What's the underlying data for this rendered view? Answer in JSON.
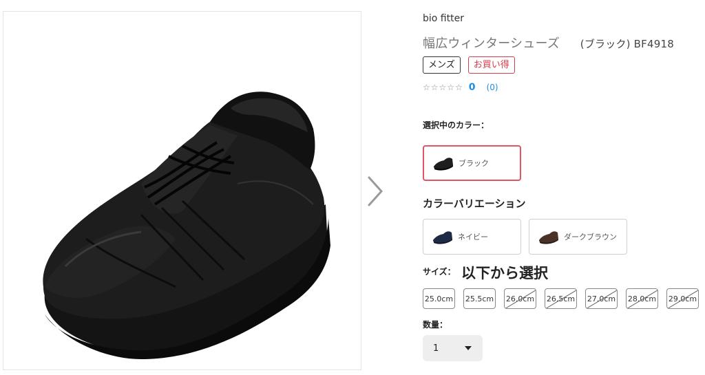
{
  "product": {
    "brand": "bio fitter",
    "title": "幅広ウィンターシューズ",
    "title_suffix": "(ブラック) BF4918",
    "image_icon": "black-walking-shoe-photo",
    "tags": [
      {
        "label": "メンズ"
      },
      {
        "label": "お買い得"
      }
    ],
    "rating": {
      "stars": "☆☆☆☆☆",
      "score": "0",
      "count": "(0)"
    }
  },
  "gallery": {
    "next_icon": "chevron-right-icon"
  },
  "color": {
    "selected_label": "選択中のカラー：",
    "selected": {
      "name": "ブラック",
      "color": "#1e1e1e"
    }
  },
  "variation": {
    "title": "カラーバリエーション",
    "options": [
      {
        "name": "ネイビー",
        "color": "#1f2a44"
      },
      {
        "name": "ダークブラウン",
        "color": "#4a3326"
      }
    ]
  },
  "size": {
    "label": "サイズ：",
    "prompt": "以下から選択",
    "options": [
      {
        "label": "25.0cm",
        "available": true
      },
      {
        "label": "25.5cm",
        "available": true
      },
      {
        "label": "26.0cm",
        "available": false
      },
      {
        "label": "26.5cm",
        "available": false
      },
      {
        "label": "27.0cm",
        "available": false
      },
      {
        "label": "28.0cm",
        "available": false
      },
      {
        "label": "29.0cm",
        "available": false
      }
    ]
  },
  "quantity": {
    "label": "数量：",
    "value": "1"
  },
  "colors": {
    "accent": "#e05466",
    "link": "#1b8fe0",
    "tag_red": "#d83a4a"
  }
}
